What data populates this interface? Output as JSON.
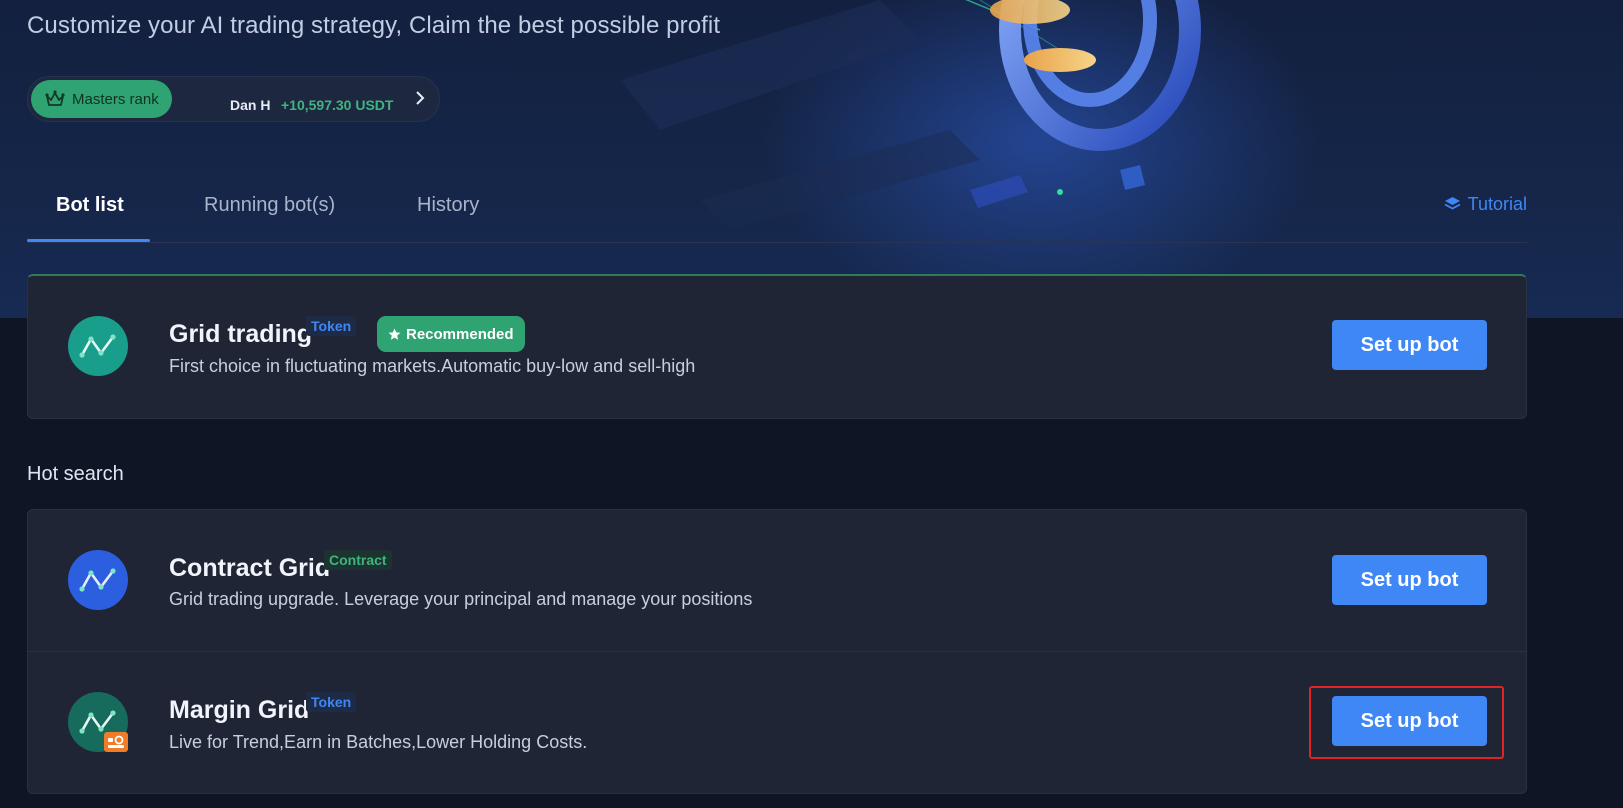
{
  "header": {
    "subtitle": "Customize your AI trading strategy, Claim the best possible profit"
  },
  "masters_rank": {
    "badge_label": "Masters rank",
    "user": "Dan H",
    "profit": "+10,597.30 USDT"
  },
  "tabs": [
    {
      "label": "Bot list",
      "active": true
    },
    {
      "label": "Running bot(s)",
      "active": false
    },
    {
      "label": "History",
      "active": false
    }
  ],
  "tutorial_label": "Tutorial",
  "featured_bot": {
    "title": "Grid trading",
    "tag": "Token",
    "badge": "Recommended",
    "description": "First choice in fluctuating markets.Automatic buy-low and sell-high",
    "button": "Set up bot",
    "icon": "grid-line-icon",
    "icon_color": "#1a9e8c"
  },
  "hot_search": {
    "label": "Hot search",
    "bots": [
      {
        "title": "Contract Grid",
        "tag": "Contract",
        "description": "Grid trading upgrade. Leverage your principal and manage your positions",
        "button": "Set up bot",
        "icon": "grid-line-icon",
        "icon_color": "#2c5ee0"
      },
      {
        "title": "Margin Grid",
        "tag": "Token",
        "description": "Live for Trend,Earn in Batches,Lower Holding Costs.",
        "button": "Set up bot",
        "icon": "grid-line-icon",
        "icon_color": "#176b5c",
        "icon_badge_color": "#f07c2a"
      }
    ]
  },
  "colors": {
    "accent_blue": "#3f87f5",
    "accent_green": "#2fa472",
    "profit_green": "#3fb47d",
    "highlight_red": "#e02424",
    "background": "#0f1525",
    "card": "#1f2535"
  }
}
